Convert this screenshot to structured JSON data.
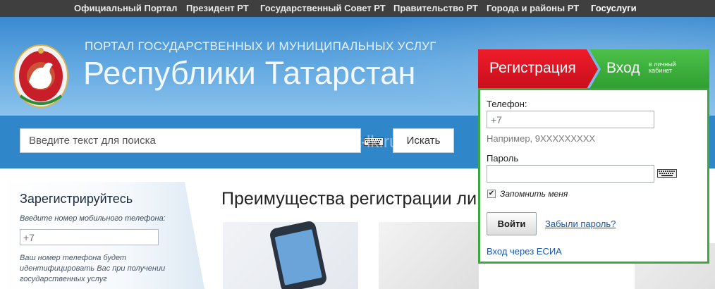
{
  "topnav": {
    "items": [
      {
        "label": "Официальный Портал"
      },
      {
        "label": "Президент РТ"
      },
      {
        "label": "Государственный Совет РТ"
      },
      {
        "label": "Правительство РТ"
      },
      {
        "label": "Города и районы РТ"
      },
      {
        "label": "Госуслуги"
      }
    ],
    "active": "Госуслуги"
  },
  "header": {
    "subtitle": "ПОРТАЛ ГОСУДАРСТВЕННЫХ И МУНИЦИПАЛЬНЫХ УСЛУГ",
    "title": "Республики Татарстан"
  },
  "search": {
    "placeholder": "Введите текст для поиска",
    "button_label": "Искать"
  },
  "watermark": "gosuslugi-rt-lk.ru",
  "register_panel": {
    "title": "Зарегистрируйтесь",
    "hint": "Введите номер мобильного телефона:",
    "phone_placeholder": "+7",
    "note": "Ваш номер телефона будет идентифицировать Вас при получении государственных услуг"
  },
  "benefits": {
    "title": "Преимущества регистрации ли"
  },
  "auth": {
    "tab_register": "Регистрация",
    "tab_login": "Вход",
    "tab_login_sub": "в личный кабинет",
    "phone_label": "Телефон:",
    "phone_placeholder": "+7",
    "phone_example": "Например, 9XXXXXXXXX",
    "password_label": "Пароль",
    "remember_label": "Запомнить меня",
    "remember_checked": true,
    "login_button": "Войти",
    "forgot_link": "Забыли пароль?",
    "esia_link": "Вход через ЕСИА"
  },
  "colors": {
    "topnav_bg": "#3f3f3f",
    "header_blue": "#3a8ad0",
    "search_band": "#2f86c9",
    "register_red": "#e01b28",
    "login_green": "#3da83d",
    "link_blue": "#1a56a8"
  },
  "icons": {
    "emblem": "tatarstan-emblem-icon",
    "keyboard": "keyboard-icon"
  }
}
